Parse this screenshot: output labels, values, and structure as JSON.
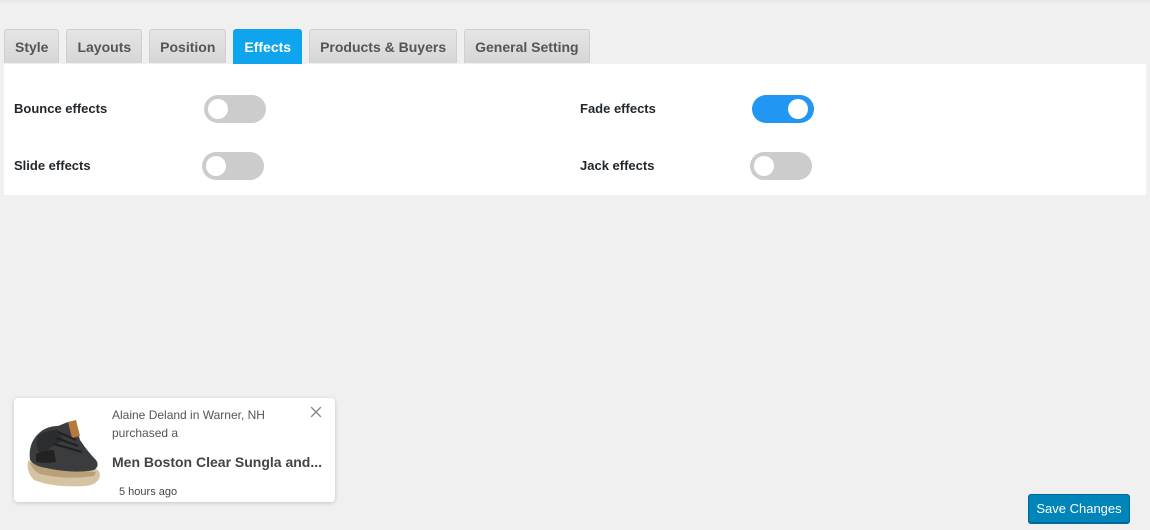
{
  "tabs": [
    {
      "label": "Style",
      "active": false
    },
    {
      "label": "Layouts",
      "active": false
    },
    {
      "label": "Position",
      "active": false
    },
    {
      "label": "Effects",
      "active": true
    },
    {
      "label": "Products & Buyers",
      "active": false
    },
    {
      "label": "General Setting",
      "active": false
    }
  ],
  "effects": {
    "bounce": {
      "label": "Bounce effects",
      "enabled": false
    },
    "fade": {
      "label": "Fade effects",
      "enabled": true
    },
    "slide": {
      "label": "Slide effects",
      "enabled": false
    },
    "jack": {
      "label": "Jack effects",
      "enabled": false
    }
  },
  "notification": {
    "buyer_line": "Alaine Deland in Warner, NH",
    "action_line": "purchased a",
    "product": "Men Boston Clear Sungla and...",
    "time": "5 hours ago",
    "icons": {
      "close": "close-icon",
      "thumbnail": "shoe-product-image"
    }
  },
  "save_button": {
    "label": "Save Changes"
  },
  "colors": {
    "active_tab": "#0ea5ee",
    "toggle_on": "#2196f3",
    "toggle_off": "#cccccc",
    "save_button": "#0085ba"
  }
}
